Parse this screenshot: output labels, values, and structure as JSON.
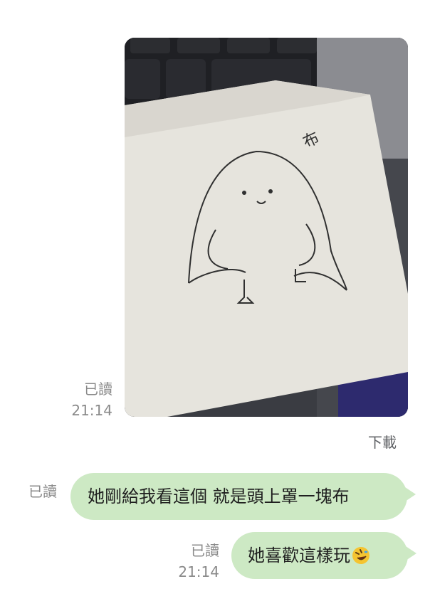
{
  "messages": [
    {
      "type": "image",
      "read_label": "已讀",
      "time": "21:14",
      "download_label": "下載",
      "image_icon": "photo-of-penguin-drawing",
      "image_text": "布"
    },
    {
      "type": "text",
      "read_label": "已讀",
      "text": "她剛給我看這個 就是頭上罩一塊布"
    },
    {
      "type": "text",
      "read_label": "已讀",
      "time": "21:14",
      "text": "她喜歡這樣玩",
      "emoji_icon": "rolling-on-floor-laughing-icon"
    }
  ],
  "colors": {
    "bubble": "#cde9c4",
    "meta_text": "#8a8a8a",
    "background": "#ffffff"
  }
}
